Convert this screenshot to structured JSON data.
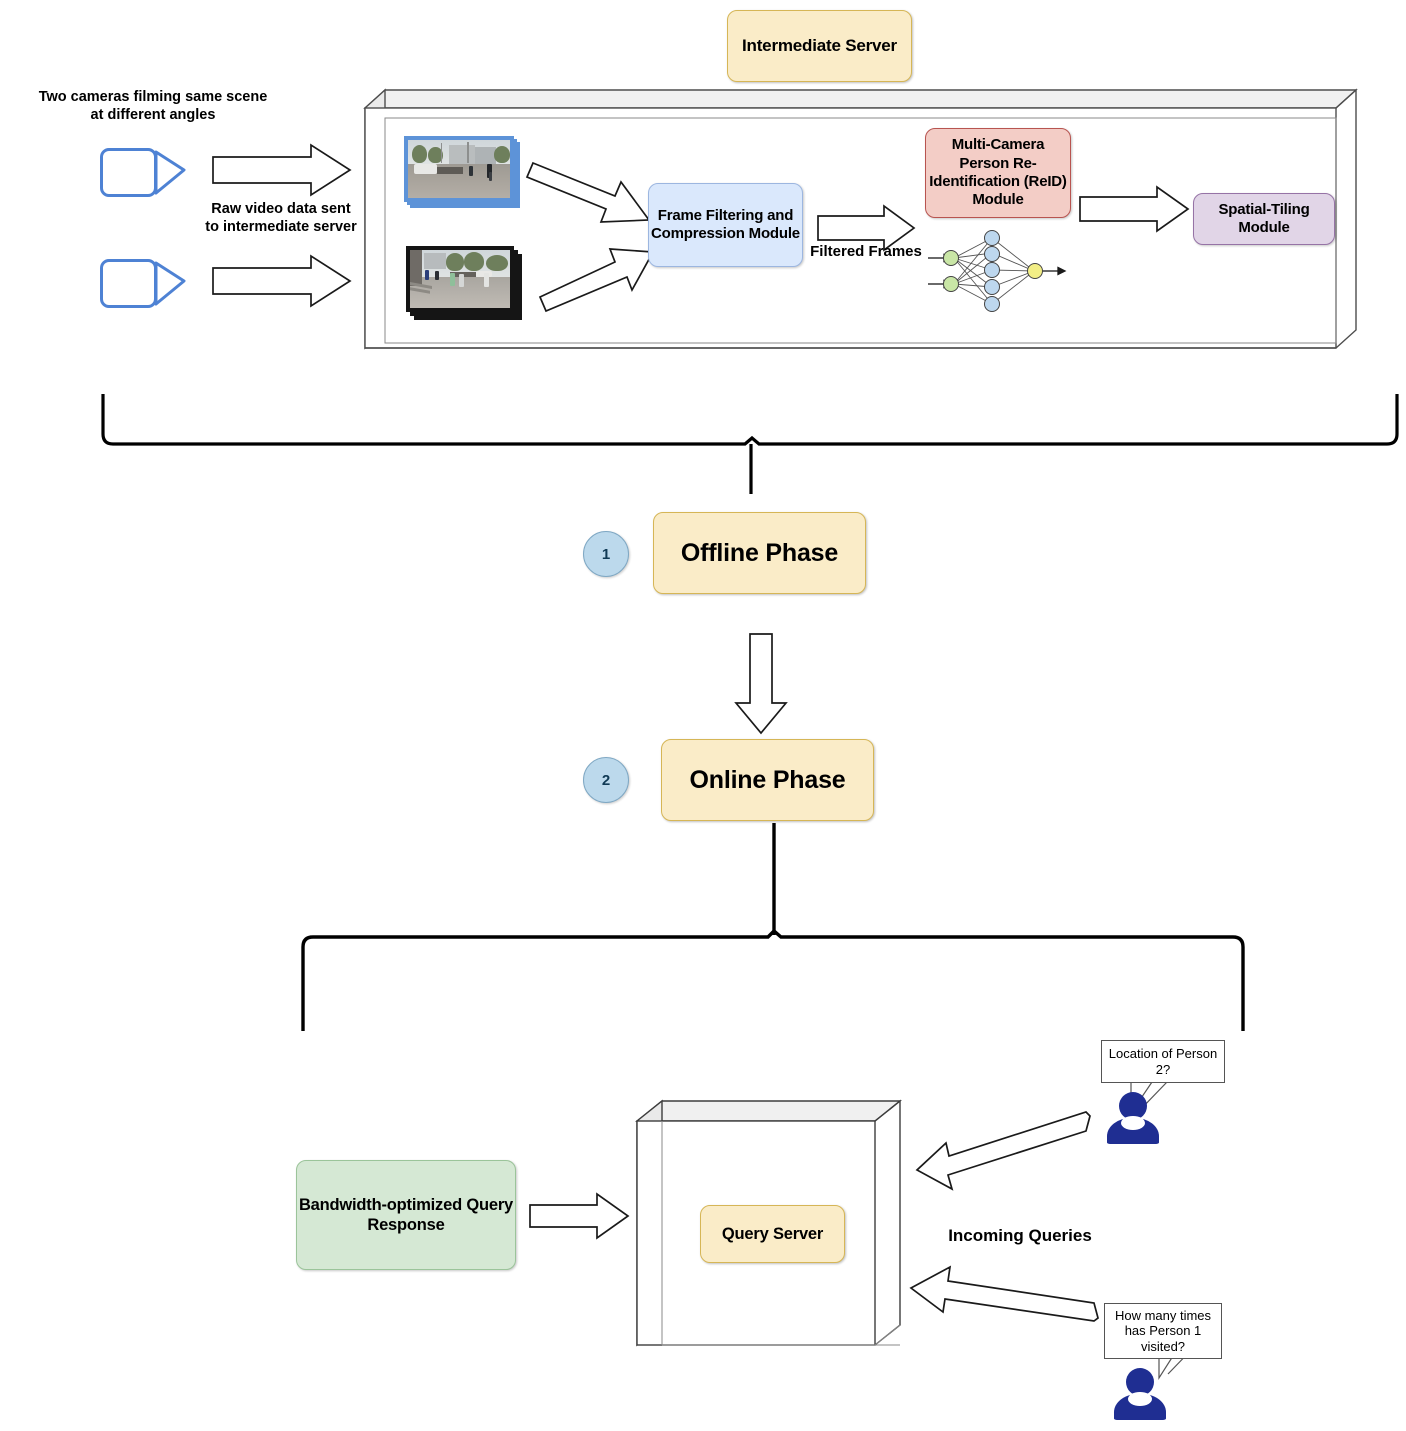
{
  "diagram": {
    "title_box": {
      "label": "Intermediate\nServer"
    },
    "camera_section": {
      "caption": "Two cameras filming same scene\nat different angles",
      "transfer_label": "Raw video data sent\nto intermediate server",
      "cameras": [
        {
          "name": "camera-1"
        },
        {
          "name": "camera-2"
        }
      ]
    },
    "server_modules": [
      {
        "id": "frame-filtering",
        "label": "Frame Filtering and\nCompression\nModule",
        "color": "#dae8fc"
      },
      {
        "id": "reid",
        "label": "Multi-Camera\nPerson Re-\nIdentification\n(ReID) Module",
        "color": "#f3cdc6"
      },
      {
        "id": "spatial-tiling",
        "label": "Spatial-Tiling\nModule",
        "color": "#e1d5e7"
      }
    ],
    "edge_labels": {
      "filtered_frames": "Filtered Frames",
      "incoming_queries": "Incoming Queries"
    },
    "neural_net": {
      "input_nodes": 2,
      "hidden_nodes": 5,
      "output_nodes": 1,
      "input_color": "#c9e6a6",
      "hidden_color": "#bdd7ee",
      "output_color": "#f2ee86"
    },
    "phases": [
      {
        "number": "1",
        "label": "Offline Phase"
      },
      {
        "number": "2",
        "label": "Online Phase"
      }
    ],
    "query_section": {
      "response_box": {
        "label": "Bandwidth-optimized\nQuery Response"
      },
      "query_server": {
        "label": "Query Server"
      },
      "queries": [
        {
          "id": "query-1",
          "text": "Location of Person 2?"
        },
        {
          "id": "query-2",
          "text": "How many times has Person 1 visited?"
        }
      ]
    }
  }
}
